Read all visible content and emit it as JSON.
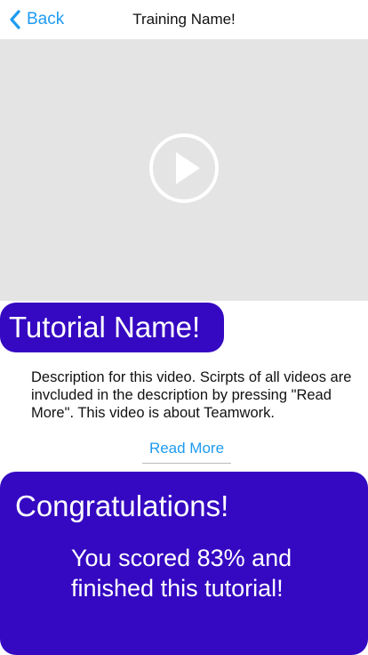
{
  "header": {
    "back_label": "Back",
    "back_icon": "chevron-left-icon",
    "title": "Training Name!"
  },
  "video": {
    "play_icon": "play-circle-icon"
  },
  "tutorial": {
    "name": "Tutorial Name!",
    "description": "Description for this video. Scirpts of all videos are invcluded in the description by pressing \"Read More\". This video is about Teamwork.",
    "read_more_label": "Read More"
  },
  "result": {
    "title": "Congratulations!",
    "message": "You scored 83% and finished this tutorial!",
    "score_percent": 83
  },
  "colors": {
    "accent": "#1e9bf0",
    "brand": "#3508c2",
    "video_background": "#e4e4e4"
  }
}
